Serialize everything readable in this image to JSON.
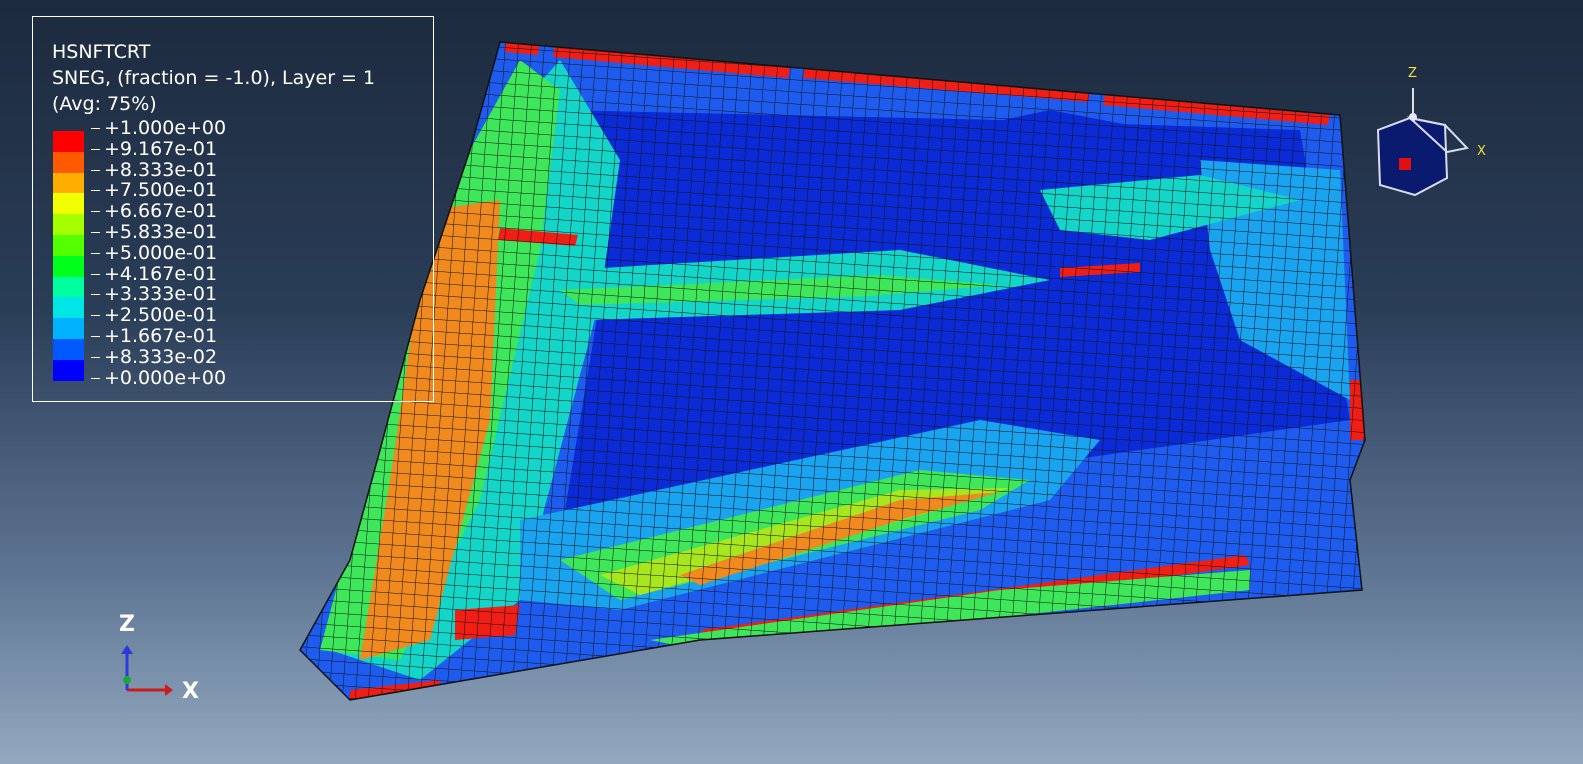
{
  "legend": {
    "variable": "HSNFTCRT",
    "detail": "SNEG, (fraction = -1.0), Layer = 1",
    "averaging": "(Avg: 75%)",
    "ticks": [
      "+1.000e+00",
      "+9.167e-01",
      "+8.333e-01",
      "+7.500e-01",
      "+6.667e-01",
      "+5.833e-01",
      "+5.000e-01",
      "+4.167e-01",
      "+3.333e-01",
      "+2.500e-01",
      "+1.667e-01",
      "+8.333e-02",
      "+0.000e+00"
    ],
    "swatch_colors": [
      "#ff0000",
      "#ff5a00",
      "#ffad00",
      "#f2ff00",
      "#a6ff00",
      "#53ff00",
      "#00ff1a",
      "#00ff9e",
      "#00e5e5",
      "#00b2ff",
      "#005aff",
      "#0000ff"
    ]
  },
  "triad": {
    "z_label": "Z",
    "x_label": "X"
  },
  "view_cube": {
    "z_label": "Z",
    "x_label": "X"
  },
  "contour_colors": {
    "deep_blue": "#0a2bd6",
    "blue": "#1e5cf0",
    "light_blue": "#1aa4f0",
    "cyan": "#14d6c8",
    "green": "#3ee65a",
    "yellow_green": "#a8e61e",
    "orange": "#f08a1e",
    "red": "#f01e14"
  }
}
